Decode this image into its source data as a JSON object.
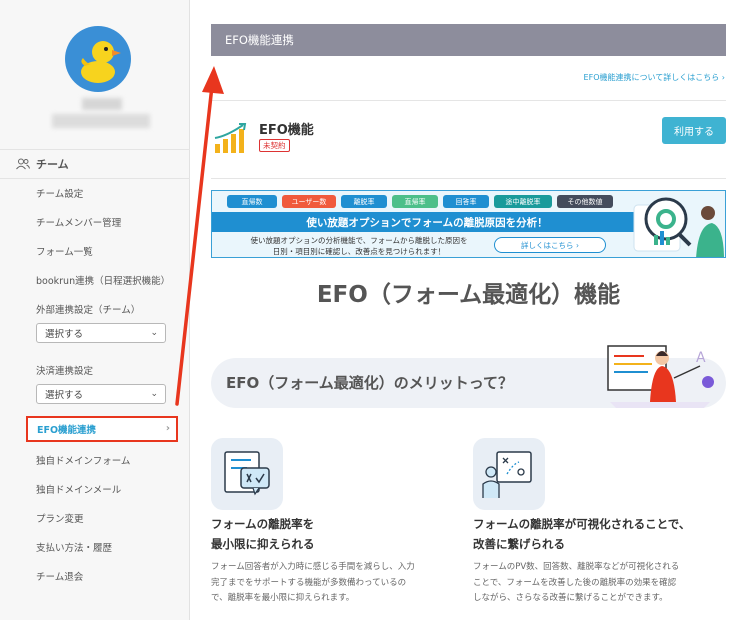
{
  "sidebar": {
    "team_label": "チーム",
    "items": [
      {
        "label": "チーム設定"
      },
      {
        "label": "チームメンバー管理"
      },
      {
        "label": "フォーム一覧"
      },
      {
        "label": "bookrun連携（日程選択機能）"
      },
      {
        "label": "外部連携設定（チーム）"
      },
      {
        "label": "決済連携設定"
      },
      {
        "label": "EFO機能連携"
      },
      {
        "label": "独自ドメインフォーム"
      },
      {
        "label": "独自ドメインメール"
      },
      {
        "label": "プラン変更"
      },
      {
        "label": "支払い方法・履歴"
      },
      {
        "label": "チーム退会"
      }
    ],
    "external_select": "選択する",
    "payment_select": "選択する"
  },
  "header": {
    "title": "EFO機能連携",
    "detail_link": "EFO機能連携について詳しくはこちら"
  },
  "efo": {
    "title": "EFO機能",
    "badge": "未契約",
    "use_button": "利用する"
  },
  "banner": {
    "tags": [
      {
        "label": "直帰数",
        "color": "#1f8fd1"
      },
      {
        "label": "ユーザー数",
        "color": "#f05a3c"
      },
      {
        "label": "離脱率",
        "color": "#1f8fd1"
      },
      {
        "label": "直帰率",
        "color": "#4cbf8a"
      },
      {
        "label": "回答率",
        "color": "#1f8fd1"
      },
      {
        "label": "途中離脱率",
        "color": "#1a9b9b"
      },
      {
        "label": "その他数値",
        "color": "#444c5c"
      }
    ],
    "headline": "使い放題オプションでフォームの離脱原因を分析！",
    "text_line1": "使い放題オプションの分析機能で、フォームから離脱した原因を",
    "text_line2": "日別・項目別に確認し、改善点を見つけられます！",
    "button": "詳しくはこちら"
  },
  "main": {
    "big_title": "EFO（フォーム最適化）機能",
    "merit_title": "EFO（フォーム最適化）のメリットって？"
  },
  "features": [
    {
      "title_line1": "フォームの離脱率を",
      "title_line2": "最小限に抑えられる",
      "desc_line1": "フォーム回答者が入力時に感じる手間を減らし、入力",
      "desc_line2": "完了までをサポートする機能が多数備わっているの",
      "desc_line3": "で、離脱率を最小限に抑えられます。"
    },
    {
      "title_line1": "フォームの離脱率が可視化されることで、",
      "title_line2": "改善に繋げられる",
      "desc_line1": "フォームのPV数、回答数、離脱率などが可視化される",
      "desc_line2": "ことで、フォームを改善した後の離脱率の効果を確認",
      "desc_line3": "しながら、さらなる改善に繋げることができます。"
    }
  ],
  "colors": {
    "accent": "#2a9fd0",
    "header_bg": "#8d8d9c",
    "highlight": "#e8361e",
    "button": "#3fb3d2"
  }
}
